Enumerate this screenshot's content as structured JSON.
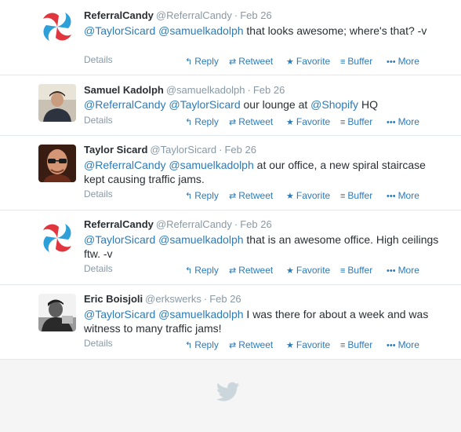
{
  "tweets": [
    {
      "avatar": "referralcandy-logo",
      "name": "ReferralCandy",
      "handle": "@ReferralCandy",
      "sep": "·",
      "time": "Feb 26",
      "segments": [
        {
          "t": "@TaylorSicard",
          "m": true
        },
        {
          "t": " ",
          "m": false
        },
        {
          "t": "@samuelkadolph",
          "m": true
        },
        {
          "t": " that looks awesome; where's that? -v",
          "m": false
        }
      ]
    },
    {
      "avatar": "samuel-kadolph-photo",
      "name": "Samuel Kadolph",
      "handle": "@samuelkadolph",
      "sep": "·",
      "time": "Feb 26",
      "segments": [
        {
          "t": "@ReferralCandy",
          "m": true
        },
        {
          "t": " ",
          "m": false
        },
        {
          "t": "@TaylorSicard",
          "m": true
        },
        {
          "t": " our lounge at ",
          "m": false
        },
        {
          "t": "@Shopify",
          "m": true
        },
        {
          "t": " HQ",
          "m": false
        }
      ]
    },
    {
      "avatar": "taylor-sicard-photo",
      "name": "Taylor Sicard",
      "handle": "@TaylorSicard",
      "sep": "·",
      "time": "Feb 26",
      "segments": [
        {
          "t": "@ReferralCandy",
          "m": true
        },
        {
          "t": " ",
          "m": false
        },
        {
          "t": "@samuelkadolph",
          "m": true
        },
        {
          "t": " at our office, a new spiral staircase kept causing traffic jams.",
          "m": false
        }
      ]
    },
    {
      "avatar": "referralcandy-logo",
      "name": "ReferralCandy",
      "handle": "@ReferralCandy",
      "sep": "·",
      "time": "Feb 26",
      "segments": [
        {
          "t": "@TaylorSicard",
          "m": true
        },
        {
          "t": " ",
          "m": false
        },
        {
          "t": "@samuelkadolph",
          "m": true
        },
        {
          "t": " that is an awesome office. High ceilings ftw. -v",
          "m": false
        }
      ]
    },
    {
      "avatar": "eric-boisjoli-photo",
      "name": "Eric Boisjoli",
      "handle": "@erkswerks",
      "sep": "·",
      "time": "Feb 26",
      "segments": [
        {
          "t": "@TaylorSicard",
          "m": true
        },
        {
          "t": " ",
          "m": false
        },
        {
          "t": "@samuelkadolph",
          "m": true
        },
        {
          "t": " I was there for about a week and was witness to many traffic jams!",
          "m": false
        }
      ]
    }
  ],
  "labels": {
    "details": "Details",
    "reply": "Reply",
    "retweet": "Retweet",
    "favorite": "Favorite",
    "buffer": "Buffer",
    "more": "More"
  },
  "icons": {
    "reply": "reply-arrow-icon",
    "retweet": "retweet-icon",
    "favorite": "star-icon",
    "buffer": "buffer-stack-icon",
    "more": "ellipsis-icon",
    "footer": "twitter-bird-icon"
  },
  "colors": {
    "link": "#2b7bb9",
    "muted": "#8899a6",
    "background": "#f5f5f5"
  }
}
